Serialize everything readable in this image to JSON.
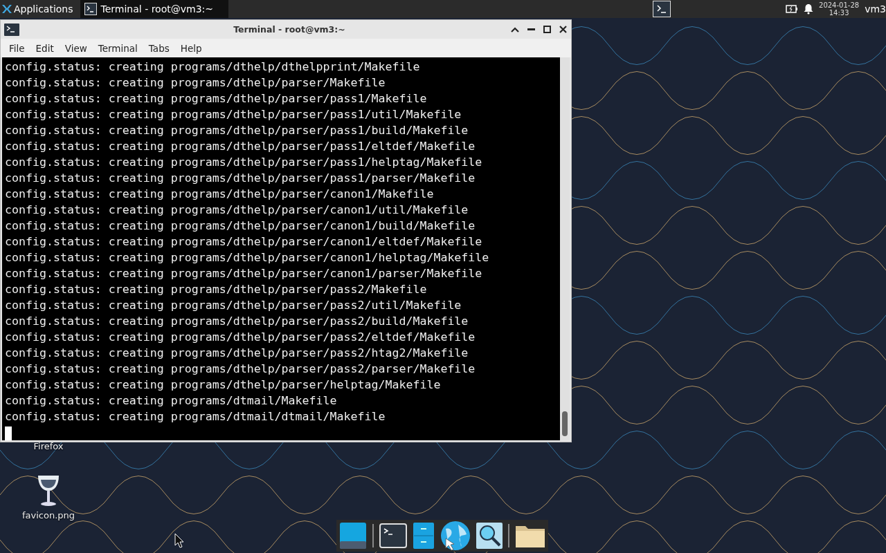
{
  "panel": {
    "apps_label": "Applications",
    "tasks": [
      {
        "label": "Terminal - root@vm3:~",
        "selected": true
      }
    ],
    "date": "2024-01-28",
    "time": "14:33",
    "user": "vm3"
  },
  "window": {
    "title": "Terminal - root@vm3:~",
    "menu": [
      "File",
      "Edit",
      "View",
      "Terminal",
      "Tabs",
      "Help"
    ],
    "lines": [
      "config.status: creating programs/dthelp/dthelpprint/Makefile",
      "config.status: creating programs/dthelp/parser/Makefile",
      "config.status: creating programs/dthelp/parser/pass1/Makefile",
      "config.status: creating programs/dthelp/parser/pass1/util/Makefile",
      "config.status: creating programs/dthelp/parser/pass1/build/Makefile",
      "config.status: creating programs/dthelp/parser/pass1/eltdef/Makefile",
      "config.status: creating programs/dthelp/parser/pass1/helptag/Makefile",
      "config.status: creating programs/dthelp/parser/pass1/parser/Makefile",
      "config.status: creating programs/dthelp/parser/canon1/Makefile",
      "config.status: creating programs/dthelp/parser/canon1/util/Makefile",
      "config.status: creating programs/dthelp/parser/canon1/build/Makefile",
      "config.status: creating programs/dthelp/parser/canon1/eltdef/Makefile",
      "config.status: creating programs/dthelp/parser/canon1/helptag/Makefile",
      "config.status: creating programs/dthelp/parser/canon1/parser/Makefile",
      "config.status: creating programs/dthelp/parser/pass2/Makefile",
      "config.status: creating programs/dthelp/parser/pass2/util/Makefile",
      "config.status: creating programs/dthelp/parser/pass2/build/Makefile",
      "config.status: creating programs/dthelp/parser/pass2/eltdef/Makefile",
      "config.status: creating programs/dthelp/parser/pass2/htag2/Makefile",
      "config.status: creating programs/dthelp/parser/pass2/parser/Makefile",
      "config.status: creating programs/dthelp/parser/helptag/Makefile",
      "config.status: creating programs/dtmail/Makefile",
      "config.status: creating programs/dtmail/dtmail/Makefile"
    ]
  },
  "desktop_icons": [
    {
      "label": "Firefox",
      "kind": "hidden"
    },
    {
      "label": "favicon.png"
    }
  ],
  "dock": [
    {
      "kind": "desktop"
    },
    {
      "kind": "separator"
    },
    {
      "kind": "terminal"
    },
    {
      "kind": "cabinet"
    },
    {
      "kind": "browser"
    },
    {
      "kind": "search"
    },
    {
      "kind": "separator"
    },
    {
      "kind": "folder"
    }
  ]
}
